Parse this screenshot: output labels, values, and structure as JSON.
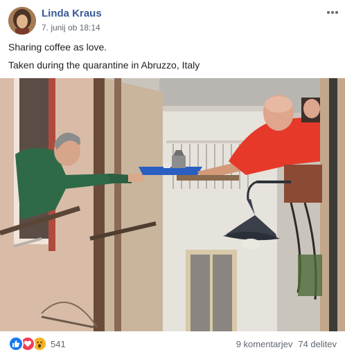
{
  "post": {
    "author": "Linda Kraus",
    "timestamp": "7. junij ob 18:14",
    "caption_line1": "Sharing coffee as love.",
    "caption_line2": "Taken during the quarantine in Abruzzo, Italy"
  },
  "footer": {
    "reaction_icons": [
      "like-icon",
      "love-icon",
      "wow-icon"
    ],
    "reaction_count": "541",
    "comments": "9 komentarjev",
    "shares": "74 delitev"
  },
  "colors": {
    "author_link": "#385898",
    "like": "#1877f2",
    "love": "#f33e58",
    "wow": "#f7b125"
  }
}
